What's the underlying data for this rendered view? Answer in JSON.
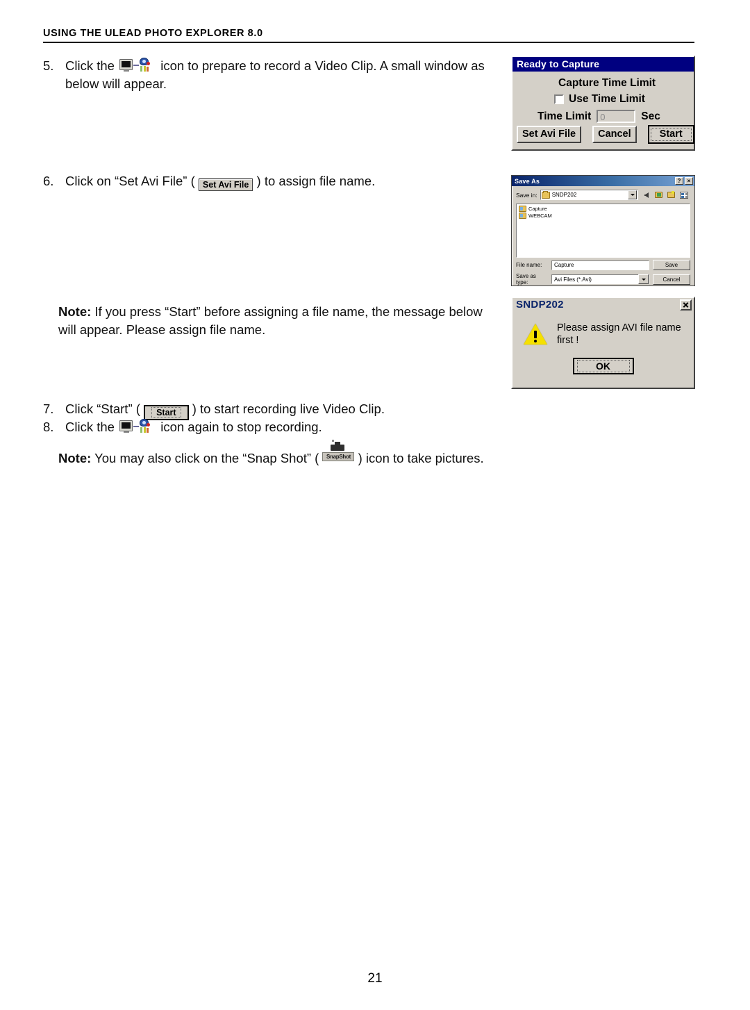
{
  "header": {
    "title": "USING THE ULEAD PHOTO EXPLORER 8.0"
  },
  "steps": {
    "step5": {
      "num": "5.",
      "text_before": "Click the",
      "icon": "camera-record-icon",
      "text_after": "icon to prepare to record a Video Clip. A small window as below will appear."
    },
    "step6": {
      "num": "6.",
      "text_before": "Click on “Set Avi File” (",
      "button_label": "Set Avi File",
      "text_after": ") to assign file name."
    },
    "note1": {
      "label": "Note:",
      "text": "If you press “Start” before assigning a file name, the message below will appear. Please assign file name."
    },
    "step7": {
      "num": "7.",
      "text_before": "Click “Start” (",
      "button_label": "Start",
      "text_after": ") to start recording live Video Clip."
    },
    "step8": {
      "num": "8.",
      "text_before": "Click the",
      "icon": "camera-record-icon",
      "text_after": "icon again to stop recording."
    },
    "note2": {
      "label": "Note:",
      "text_before": "You may also click on the “Snap Shot” (",
      "icon_label": "SnapShot",
      "text_after": ") icon to take pictures."
    }
  },
  "ready_dialog": {
    "title": "Ready to Capture",
    "caption": "Capture Time Limit",
    "use_time_limit_label": "Use Time Limit",
    "use_time_limit_checked": false,
    "time_limit_label": "Time Limit",
    "time_limit_value": "0",
    "sec_label": "Sec",
    "buttons": {
      "set_avi_file": "Set Avi File",
      "cancel": "Cancel",
      "start": "Start"
    },
    "titlebar_color": "#000080"
  },
  "saveas_dialog": {
    "title": "Save As",
    "help_btn": "?",
    "close_btn": "×",
    "save_in_label": "Save in:",
    "save_in_value": "SNDP202",
    "toolbar_icons": [
      "back-arrow-icon",
      "up-folder-icon",
      "new-folder-icon",
      "views-icon"
    ],
    "files": [
      {
        "name": "Capture",
        "icon": "folder-icon"
      },
      {
        "name": "WEBCAM",
        "icon": "folder-icon"
      }
    ],
    "file_name_label": "File name:",
    "file_name_value": "Capture",
    "save_as_type_label": "Save as type:",
    "save_as_type_value": "Avi Files (*.Avi)",
    "save_button": "Save",
    "cancel_button": "Cancel"
  },
  "message_dialog": {
    "title": "SNDP202",
    "icon": "warning-icon",
    "message": "Please assign AVI file name first !",
    "ok_button": "OK",
    "title_color": "#0a246a"
  },
  "footer": {
    "page_number": "21"
  }
}
